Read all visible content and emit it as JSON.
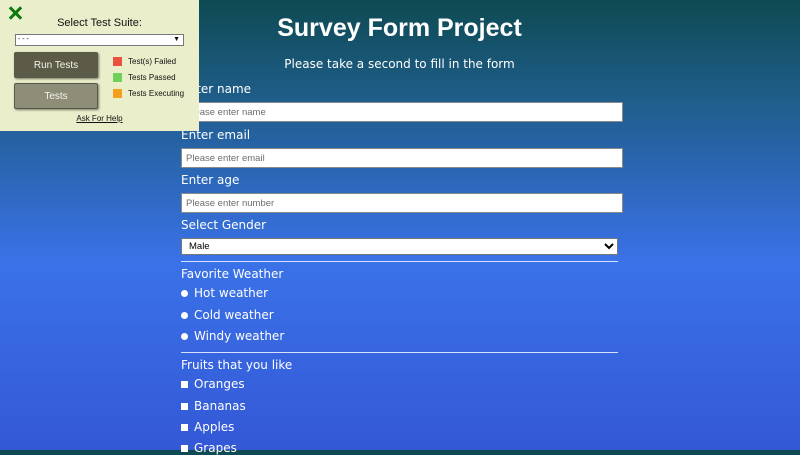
{
  "form": {
    "title": "Survey Form Project",
    "subtitle": "Please take a second to fill in the form",
    "name_label": "Enter name",
    "name_placeholder": "Please enter name",
    "email_label": "Enter email",
    "email_placeholder": "Please enter email",
    "age_label": "Enter age",
    "age_placeholder": "Please enter number",
    "gender_label": "Select Gender",
    "gender_selected": "Male",
    "weather_label": "Favorite Weather",
    "weather_options": [
      "Hot weather",
      "Cold weather",
      "Windy weather"
    ],
    "fruits_label": "Fruits that you like",
    "fruit_options": [
      "Oranges",
      "Bananas",
      "Apples",
      "Grapes"
    ]
  },
  "test_panel": {
    "suite_label": "Select Test Suite:",
    "suite_selected": "- - -",
    "run_button": "Run Tests",
    "tests_button": "Tests",
    "legend": [
      {
        "label": "Test(s) Failed",
        "color": "#e8523e"
      },
      {
        "label": "Tests Passed",
        "color": "#6fd05a"
      },
      {
        "label": "Tests Executing",
        "color": "#f2a11c"
      }
    ],
    "help_link": "Ask For Help",
    "close_icon": "close-icon"
  }
}
